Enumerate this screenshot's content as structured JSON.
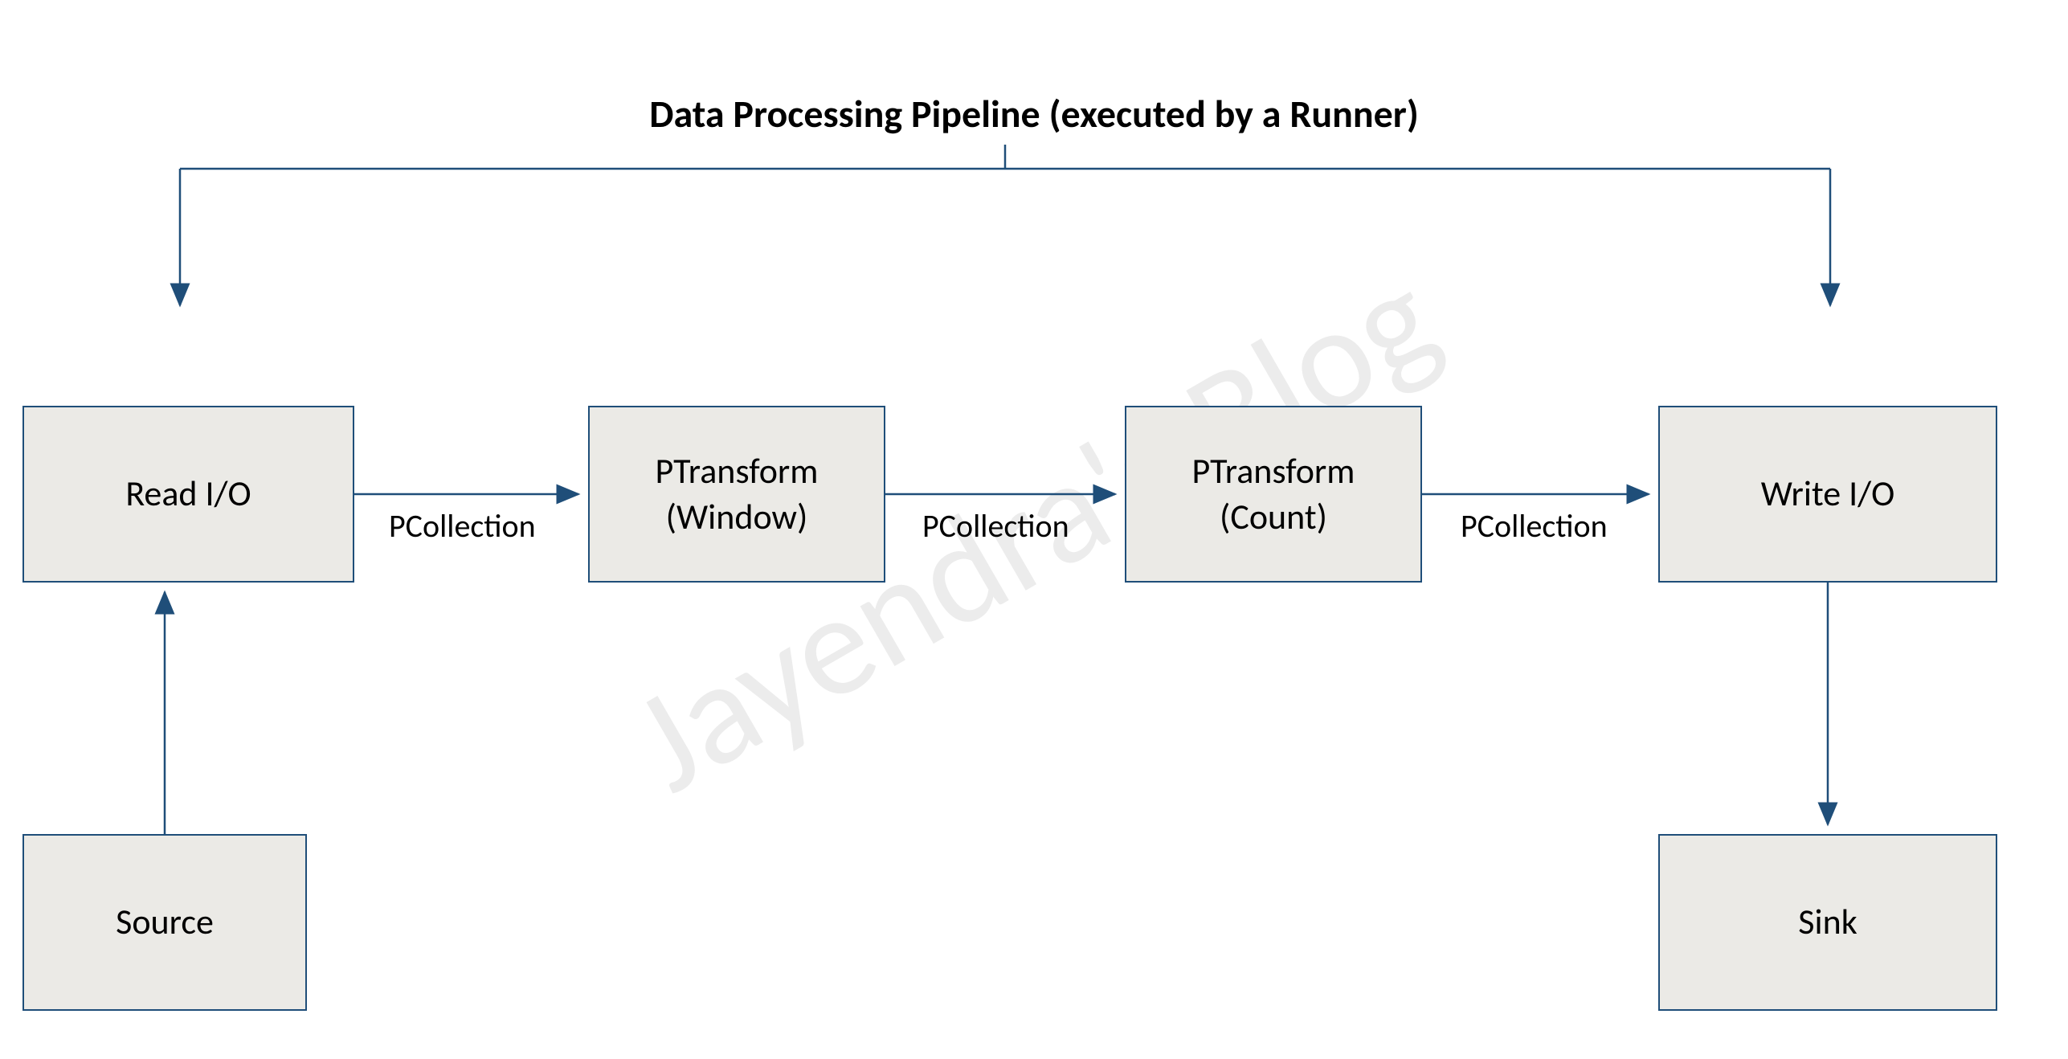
{
  "title": "Data Processing Pipeline (executed by a Runner)",
  "nodes": {
    "read": "Read I/O",
    "transform1_line1": "PTransform",
    "transform1_line2": "(Window)",
    "transform2_line1": "PTransform",
    "transform2_line2": "(Count)",
    "write": "Write I/O",
    "source": "Source",
    "sink": "Sink"
  },
  "edges": {
    "pc1": "PCollection",
    "pc2": "PCollection",
    "pc3": "PCollection"
  },
  "watermark": "Jayendra's Blog",
  "colors": {
    "line": "#1f4e79",
    "box_fill": "#ebeae6",
    "box_border": "#1f4e79"
  }
}
